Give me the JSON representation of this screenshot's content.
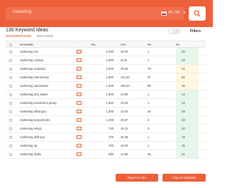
{
  "search": {
    "value": "marketing",
    "language": "PL / PL",
    "flag_colors": [
      "#ffffff",
      "#d6233c"
    ]
  },
  "results": {
    "title": "130 Keyword Ideas",
    "tabs": [
      "SUGGESTIONS",
      "RELATED"
    ],
    "filters_label": "Filters"
  },
  "table": {
    "headers": [
      "KEYWORD",
      "VOL",
      "CPC",
      "PD",
      "SD"
    ],
    "rows": [
      {
        "keyword": "marketing mix",
        "vol": "5,400",
        "cpc": "z0,00",
        "pd": "1",
        "sd": "20",
        "sd_color": "#e6f6ea"
      },
      {
        "keyword": "marketing cielowy",
        "vol": "2,900",
        "cpc": "zł,15",
        "pd": "1",
        "sd": "23",
        "sd_color": "#e6f6ea"
      },
      {
        "keyword": "marketing szeptany",
        "vol": "2,400",
        "cpc": "z8,36",
        "pd": "78",
        "sd": "41",
        "sd_color": "#fff7df"
      },
      {
        "keyword": "marketing internetowy",
        "vol": "1,900",
        "cpc": "z10,33",
        "pd": "57",
        "sd": "56",
        "sd_color": "#fff7df"
      },
      {
        "keyword": "marketing automation",
        "vol": "1,600",
        "cpc": "z58,03",
        "pd": "89",
        "sd": "45",
        "sd_color": "#fff7df"
      },
      {
        "keyword": "marketing przy kawie",
        "vol": "1,600",
        "cpc": "z0,80",
        "pd": "1",
        "sd": "14",
        "sd_color": "#e6f6ea"
      },
      {
        "keyword": "marketing investment group",
        "vol": "1,600",
        "cpc": "z0,25",
        "pd": "1",
        "sd": "14",
        "sd_color": "#e6f6ea"
      },
      {
        "keyword": "marketing afiliacyjny",
        "vol": "1,300",
        "cpc": "z4,03",
        "pd": "34",
        "sd": "29",
        "sd_color": "#e6f6ea"
      },
      {
        "keyword": "marketing bezpośredni",
        "vol": "1,300",
        "cpc": "z0,67",
        "pd": "3",
        "sd": "19",
        "sd_color": "#e6f6ea"
      },
      {
        "keyword": "marketing relacji",
        "vol": "720",
        "cpc": "z0,12",
        "pd": "3",
        "sd": "20",
        "sd_color": "#e6f6ea"
      },
      {
        "keyword": "marketing definicja",
        "vol": "700",
        "cpc": "z0,38",
        "pd": "1",
        "sd": "19",
        "sd_color": "#e6f6ea"
      },
      {
        "keyword": "marketing 4p",
        "vol": "700",
        "cpc": "z0,00",
        "pd": "1",
        "sd": "15",
        "sd_color": "#e6f6ea"
      },
      {
        "keyword": "marketing dudla",
        "vol": "590",
        "cpc": "z2,80",
        "pd": "45",
        "sd": "31",
        "sd_color": "#e6f6ea"
      }
    ]
  },
  "actions": {
    "export_label": "Export to CSV",
    "clipboard_label": "Copy to Clipboard"
  }
}
